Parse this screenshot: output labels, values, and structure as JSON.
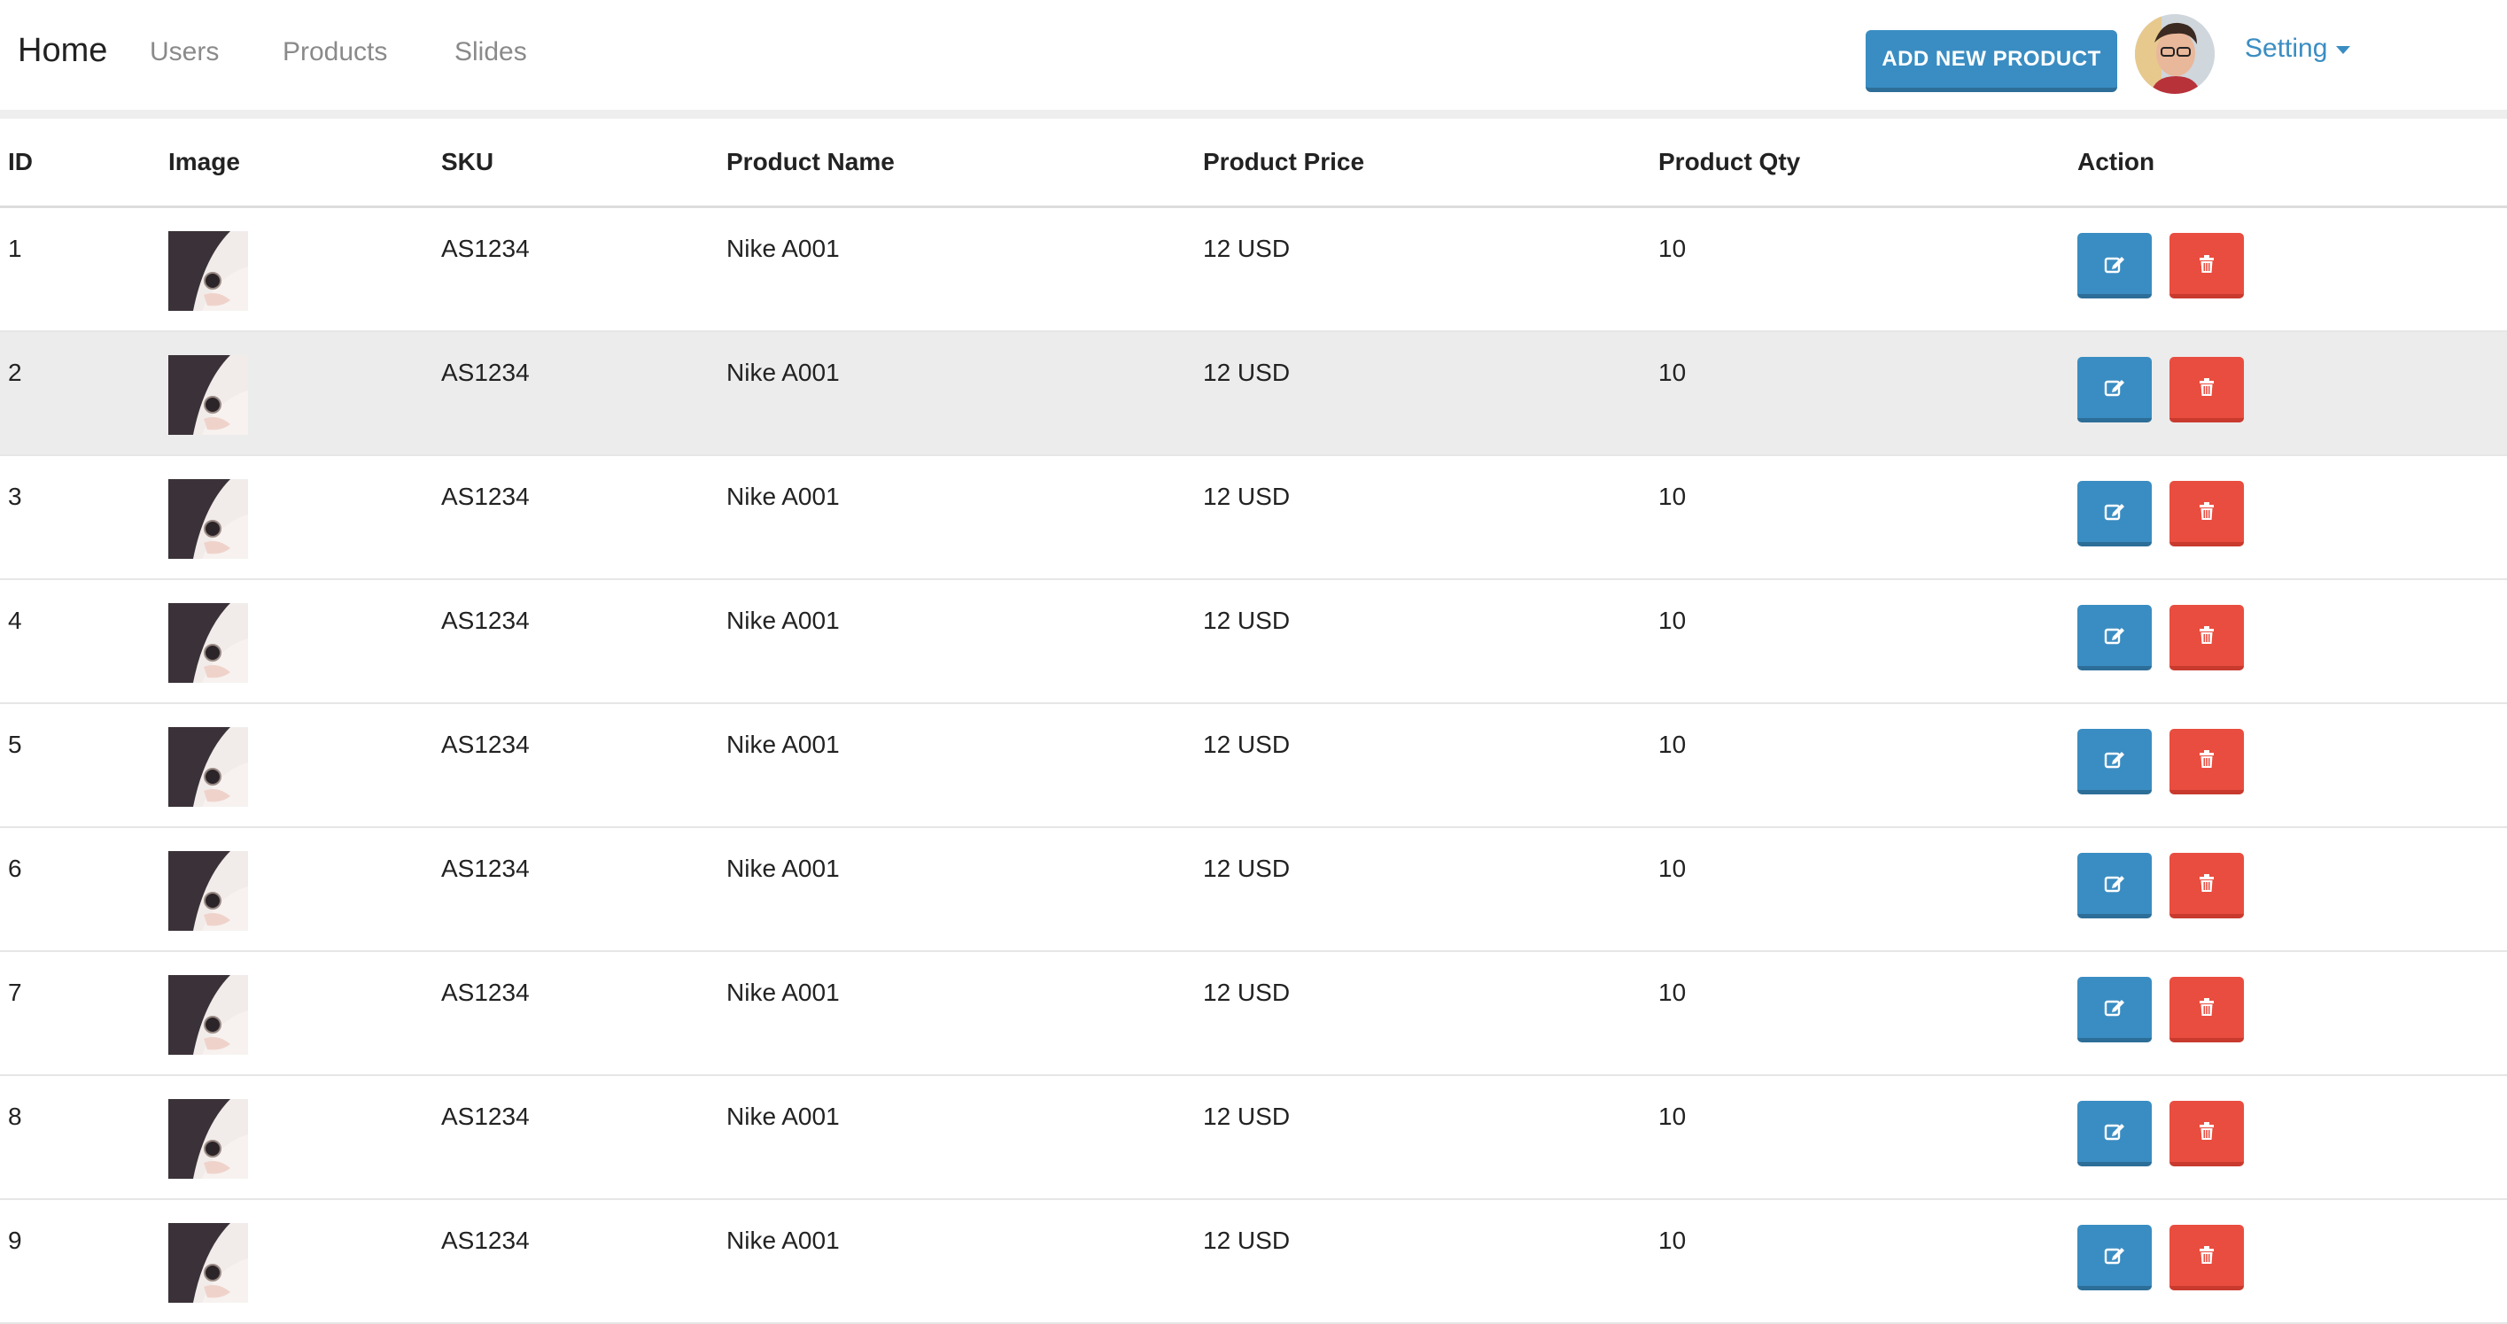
{
  "nav": {
    "brand": "Home",
    "links": [
      "Users",
      "Products",
      "Slides"
    ],
    "add_button": "ADD NEW PRODUCT",
    "setting": "Setting"
  },
  "colors": {
    "primary": "#3a8dc2",
    "danger": "#e94d3f",
    "highlight_row": "#ececec"
  },
  "table": {
    "headers": [
      "ID",
      "Image",
      "SKU",
      "Product Name",
      "Product Price",
      "Product Qty",
      "Action"
    ],
    "rows": [
      {
        "id": "1",
        "sku": "AS1234",
        "name": "Nike A001",
        "price": "12 USD",
        "qty": "10"
      },
      {
        "id": "2",
        "sku": "AS1234",
        "name": "Nike A001",
        "price": "12 USD",
        "qty": "10"
      },
      {
        "id": "3",
        "sku": "AS1234",
        "name": "Nike A001",
        "price": "12 USD",
        "qty": "10"
      },
      {
        "id": "4",
        "sku": "AS1234",
        "name": "Nike A001",
        "price": "12 USD",
        "qty": "10"
      },
      {
        "id": "5",
        "sku": "AS1234",
        "name": "Nike A001",
        "price": "12 USD",
        "qty": "10"
      },
      {
        "id": "6",
        "sku": "AS1234",
        "name": "Nike A001",
        "price": "12 USD",
        "qty": "10"
      },
      {
        "id": "7",
        "sku": "AS1234",
        "name": "Nike A001",
        "price": "12 USD",
        "qty": "10"
      },
      {
        "id": "8",
        "sku": "AS1234",
        "name": "Nike A001",
        "price": "12 USD",
        "qty": "10"
      },
      {
        "id": "9",
        "sku": "AS1234",
        "name": "Nike A001",
        "price": "12 USD",
        "qty": "10"
      }
    ],
    "highlighted_row_index": 1,
    "icons": {
      "edit": "edit-icon",
      "delete": "trash-icon",
      "image": "product-thumbnail"
    }
  }
}
